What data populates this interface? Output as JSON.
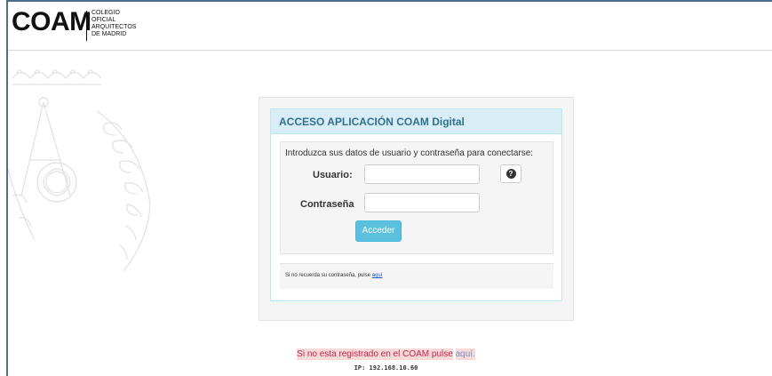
{
  "header": {
    "logo_main": "COAM",
    "logo_sub": [
      "COLEGIO",
      "OFICIAL",
      "ARQUITECTOS",
      "DE MADRID"
    ]
  },
  "login": {
    "panel_title": "ACCESO APLICACIÓN COAM Digital",
    "intro": "Introduzca sus datos de usuario y contraseña para conectarse:",
    "user_label": "Usuario:",
    "user_value": "",
    "password_label": "Contraseña",
    "password_value": "",
    "submit_label": "Acceder",
    "help_icon": "question-circle-icon",
    "forgot_text": "Si no recuerda su contraseña, pulse",
    "forgot_link": "aquí"
  },
  "footer": {
    "register_text": "Si no esta registrado en el COAM pulse",
    "register_link": "aquí.",
    "ip_text": "IP: 192.168.10.60"
  },
  "colors": {
    "frame": "#4a6e8c",
    "panel_heading_bg": "#d9edf7",
    "panel_heading_text": "#31708f",
    "button": "#5bc0de",
    "register_text": "#c7254e"
  }
}
